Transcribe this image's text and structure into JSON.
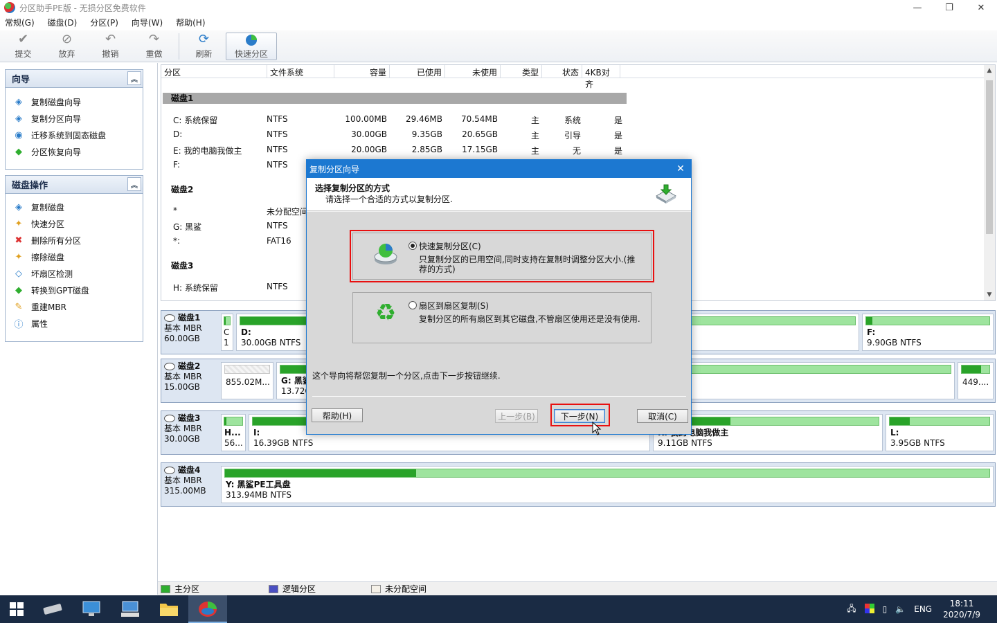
{
  "window": {
    "title": "分区助手PE版 - 无损分区免费软件",
    "controls": [
      "—",
      "❐",
      "✕"
    ]
  },
  "menu": [
    "常规(G)",
    "磁盘(D)",
    "分区(P)",
    "向导(W)",
    "帮助(H)"
  ],
  "toolbar": {
    "commit": "提交",
    "discard": "放弃",
    "undo": "撤销",
    "redo": "重做",
    "refresh": "刷新",
    "quick_partition": "快速分区"
  },
  "wizard_panel": {
    "title": "向导",
    "items": [
      "复制磁盘向导",
      "复制分区向导",
      "迁移系统到固态磁盘",
      "分区恢复向导"
    ]
  },
  "disk_ops_panel": {
    "title": "磁盘操作",
    "items": [
      "复制磁盘",
      "快速分区",
      "删除所有分区",
      "擦除磁盘",
      "坏扇区检测",
      "转换到GPT磁盘",
      "重建MBR",
      "属性"
    ]
  },
  "list": {
    "columns": [
      "分区",
      "文件系统",
      "容量",
      "已使用",
      "未使用",
      "类型",
      "状态",
      "4KB对齐"
    ],
    "disk1": {
      "label": "磁盘1",
      "rows": [
        {
          "name": "C: 系统保留",
          "fs": "NTFS",
          "cap": "100.00MB",
          "used": "29.46MB",
          "free": "70.54MB",
          "type": "主",
          "status": "系统",
          "align": "是"
        },
        {
          "name": "D:",
          "fs": "NTFS",
          "cap": "30.00GB",
          "used": "9.35GB",
          "free": "20.65GB",
          "type": "主",
          "status": "引导",
          "align": "是"
        },
        {
          "name": "E: 我的电脑我做主",
          "fs": "NTFS",
          "cap": "20.00GB",
          "used": "2.85GB",
          "free": "17.15GB",
          "type": "主",
          "status": "无",
          "align": "是"
        },
        {
          "name": "F:",
          "fs": "NTFS"
        }
      ]
    },
    "disk2": {
      "label": "磁盘2",
      "rows": [
        {
          "name": "*",
          "fs": "未分配空间"
        },
        {
          "name": "G: 黑鲨",
          "fs": "NTFS"
        },
        {
          "name": "*:",
          "fs": "FAT16"
        }
      ]
    },
    "disk3": {
      "label": "磁盘3",
      "rows": [
        {
          "name": "H: 系统保留",
          "fs": "NTFS"
        }
      ]
    }
  },
  "diskmap": {
    "disk1": {
      "name": "磁盘1",
      "type": "基本 MBR",
      "size": "60.00GB",
      "parts": [
        {
          "l1": "C",
          "l2": "1",
          "used": 0.3
        },
        {
          "l1": "D:",
          "l2": "30.00GB NTFS",
          "used": 0.31
        },
        {
          "l1": "",
          "l2": "",
          "used": 0.14
        },
        {
          "l1": "F:",
          "l2": "9.90GB NTFS",
          "used": 0.05
        }
      ]
    },
    "disk2": {
      "name": "磁盘2",
      "type": "基本 MBR",
      "size": "15.00GB",
      "parts": [
        {
          "l1": "",
          "l2": "855.02M..."
        },
        {
          "l1": "G: 黑鲨",
          "l2": "13.72G",
          "used": 0.3
        },
        {
          "l1": "",
          "l2": "",
          "used": 0.1
        },
        {
          "l1": "",
          "l2": "449....",
          "used": 0.7
        }
      ]
    },
    "disk3": {
      "name": "磁盘3",
      "type": "基本 MBR",
      "size": "30.00GB",
      "parts": [
        {
          "l1": "H...",
          "l2": "56...",
          "used": 0.1
        },
        {
          "l1": "I:",
          "l2": "16.39GB NTFS",
          "used": 0.25
        },
        {
          "l1": "K: 我的电脑我做主",
          "l2": "9.11GB NTFS",
          "used": 0.33
        },
        {
          "l1": "L:",
          "l2": "3.95GB NTFS",
          "used": 0.2
        }
      ]
    },
    "disk4": {
      "name": "磁盘4",
      "type": "基本 MBR",
      "size": "315.00MB",
      "parts": [
        {
          "l1": "Y: 黑鲨PE工具盘",
          "l2": "313.94MB NTFS",
          "used": 0.25
        }
      ]
    }
  },
  "legend": {
    "primary": "主分区",
    "logical": "逻辑分区",
    "unallocated": "未分配空间",
    "colors": {
      "primary": "#2fae2f",
      "logical": "#4a4fc1",
      "unallocated": "#f5f1e8"
    }
  },
  "dialog": {
    "title": "复制分区向导",
    "heading": "选择复制分区的方式",
    "subheading": "请选择一个合适的方式以复制分区.",
    "option1_label": "快速复制分区(C)",
    "option1_desc_line1": "只复制分区的已用空间,同时支持在复制时调整分区大小.(推",
    "option1_desc_line2": "荐的方式)",
    "option2_label": "扇区到扇区复制(S)",
    "option2_desc": "复制分区的所有扇区到其它磁盘,不管扇区使用还是没有使用.",
    "info": "这个导向将帮您复制一个分区,点击下一步按钮继续.",
    "help_button": "帮助(H)",
    "back_button": "上一步(B)",
    "next_button": "下一步(N)",
    "cancel_button": "取消(C)",
    "selected_option": "option1"
  },
  "taskbar": {
    "lang": "ENG",
    "time": "18:11",
    "date": "2020/7/9"
  },
  "colors": {
    "accent": "#1c78d1",
    "highlight_red": "#e81010",
    "used_green": "#29a329",
    "free_green": "#9ee49e"
  }
}
